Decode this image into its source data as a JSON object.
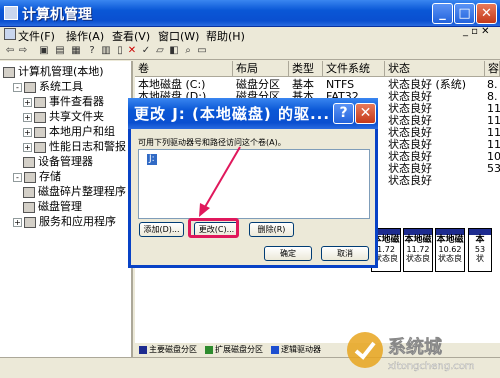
{
  "window": {
    "title": "计算机管理"
  },
  "menu": [
    "文件(F)",
    "操作(A)",
    "查看(V)",
    "窗口(W)",
    "帮助(H)"
  ],
  "tree": [
    {
      "label": "计算机管理(本地)",
      "exp": "",
      "indent": 0
    },
    {
      "label": "系统工具",
      "exp": "-",
      "indent": 1
    },
    {
      "label": "事件查看器",
      "exp": "+",
      "indent": 2
    },
    {
      "label": "共享文件夹",
      "exp": "+",
      "indent": 2
    },
    {
      "label": "本地用户和组",
      "exp": "+",
      "indent": 2
    },
    {
      "label": "性能日志和警报",
      "exp": "+",
      "indent": 2
    },
    {
      "label": "设备管理器",
      "exp": "",
      "indent": 2
    },
    {
      "label": "存储",
      "exp": "-",
      "indent": 1
    },
    {
      "label": "磁盘碎片整理程序",
      "exp": "",
      "indent": 2
    },
    {
      "label": "磁盘管理",
      "exp": "",
      "indent": 2
    },
    {
      "label": "服务和应用程序",
      "exp": "+",
      "indent": 1
    }
  ],
  "columns": [
    "卷",
    "布局",
    "类型",
    "文件系统",
    "状态",
    "容"
  ],
  "rows": [
    {
      "vol": "本地磁盘 (C:)",
      "layout": "磁盘分区",
      "type": "基本",
      "fs": "NTFS",
      "status": "状态良好 (系统)",
      "cap": "8."
    },
    {
      "vol": "本地磁盘 (D:)",
      "layout": "磁盘分区",
      "type": "基本",
      "fs": "FAT32",
      "status": "状态良好",
      "cap": "8."
    },
    {
      "vol": "",
      "layout": "",
      "type": "",
      "fs": "",
      "status": "状态良好",
      "cap": "11"
    },
    {
      "vol": "",
      "layout": "",
      "type": "",
      "fs": "",
      "status": "状态良好",
      "cap": "11"
    },
    {
      "vol": "",
      "layout": "",
      "type": "",
      "fs": "",
      "status": "状态良好",
      "cap": "11"
    },
    {
      "vol": "",
      "layout": "",
      "type": "",
      "fs": "",
      "status": "状态良好",
      "cap": "11"
    },
    {
      "vol": "",
      "layout": "",
      "type": "",
      "fs": "",
      "status": "状态良好",
      "cap": "10"
    },
    {
      "vol": "",
      "layout": "",
      "type": "",
      "fs": "",
      "status": "状态良好",
      "cap": "53"
    },
    {
      "vol": "",
      "layout": "",
      "type": "",
      "fs": "",
      "status": "状态良好",
      "cap": ""
    }
  ],
  "disk_parts": [
    {
      "title": "本地磁",
      "size": "1.72",
      "status": "状态良"
    },
    {
      "title": "本地磁",
      "size": "11.72",
      "status": "状态良"
    },
    {
      "title": "本地磁",
      "size": "10.62",
      "status": "状态良"
    },
    {
      "title": "本",
      "size": "53",
      "status": "状"
    }
  ],
  "legend": [
    {
      "label": "主要磁盘分区",
      "color": "#1d2b8f"
    },
    {
      "label": "扩展磁盘分区",
      "color": "#2e8b2e"
    },
    {
      "label": "逻辑驱动器",
      "color": "#1e4fd0"
    }
  ],
  "dialog": {
    "title": "更改 J: (本地磁盘) 的驱...",
    "desc": "可用下列驱动器号和路径访问这个卷(A)。",
    "item": "J:",
    "add": "添加(D)...",
    "change": "更改(C)...",
    "remove": "删除(R)",
    "ok": "确定",
    "cancel": "取消"
  },
  "watermark": {
    "brand": "系统城",
    "url": "xitongcheng.com"
  }
}
